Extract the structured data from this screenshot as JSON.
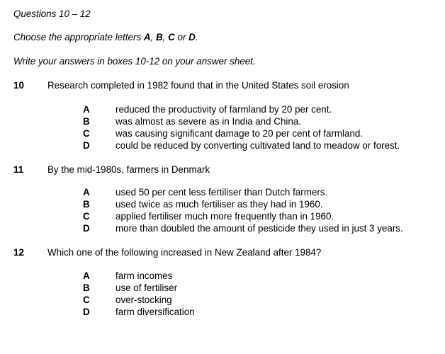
{
  "header": {
    "title": "Questions 10 – 12",
    "instruction_prefix": "Choose the appropriate letters ",
    "letter_a": "A",
    "sep1": ", ",
    "letter_b": "B",
    "sep2": ", ",
    "letter_c": "C",
    "sep3": " or ",
    "letter_d": "D",
    "instruction_suffix": ".",
    "answer_instruction": "Write your answers in boxes 10-12 on your answer sheet."
  },
  "questions": [
    {
      "number": "10",
      "stem": "Research completed in 1982 found that in the United States soil erosion",
      "options": [
        {
          "letter": "A",
          "text": "reduced the productivity of farmland by 20 per cent."
        },
        {
          "letter": "B",
          "text": "was almost as severe as in India and China."
        },
        {
          "letter": "C",
          "text": "was causing significant damage to 20 per cent of farmland."
        },
        {
          "letter": "D",
          "text": "could be reduced by converting cultivated land to meadow or forest."
        }
      ]
    },
    {
      "number": "11",
      "stem": "By the mid-1980s, farmers in Denmark",
      "options": [
        {
          "letter": "A",
          "text": "used 50 per cent less fertiliser than Dutch farmers."
        },
        {
          "letter": "B",
          "text": "used twice as much fertiliser as they had in 1960."
        },
        {
          "letter": "C",
          "text": "applied fertiliser much more frequently than in 1960."
        },
        {
          "letter": "D",
          "text": "more than doubled the amount of pesticide they used in just 3 years."
        }
      ]
    },
    {
      "number": "12",
      "stem": "Which one of the following increased in New Zealand after 1984?",
      "options": [
        {
          "letter": "A",
          "text": "farm incomes"
        },
        {
          "letter": "B",
          "text": "use of fertiliser"
        },
        {
          "letter": "C",
          "text": "over-stocking"
        },
        {
          "letter": "D",
          "text": "farm diversification"
        }
      ]
    }
  ]
}
